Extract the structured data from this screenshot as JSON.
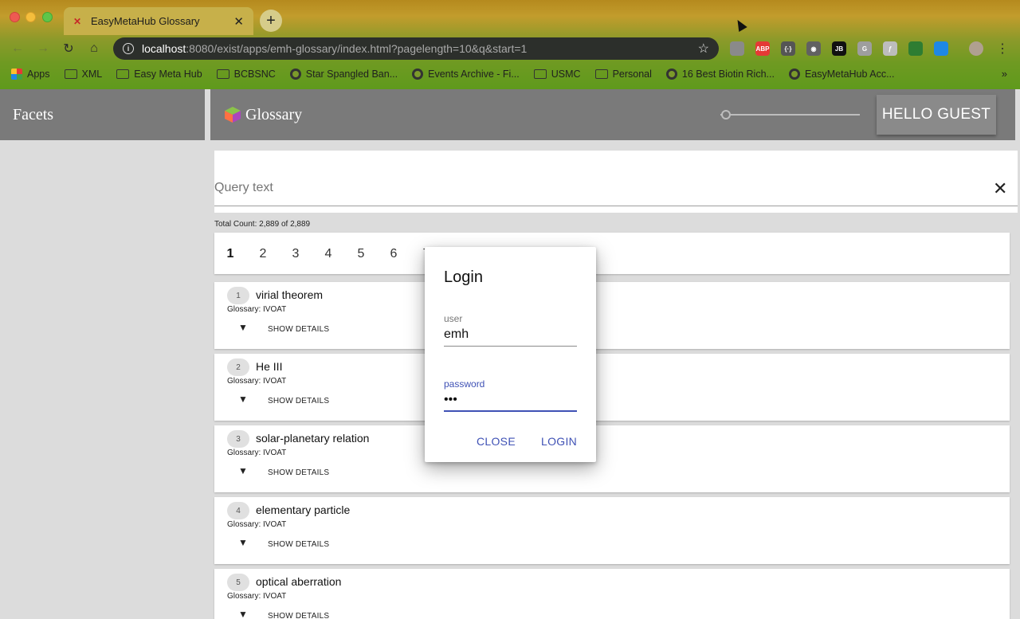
{
  "browser": {
    "tab_title": "EasyMetaHub Glossary",
    "url_host": "localhost",
    "url_path": ":8080/exist/apps/emh-glossary/index.html?pagelength=10&q&start=1",
    "bookmarks": [
      "Apps",
      "XML",
      "Easy Meta Hub",
      "BCBSNC",
      "Star Spangled Ban...",
      "Events Archive - Fi...",
      "USMC",
      "Personal",
      "16 Best Biotin Rich...",
      "EasyMetaHub Acc..."
    ],
    "bookmark_more": "»",
    "extensions": [
      {
        "name": "gear-extension-icon",
        "text": "",
        "color": "#8a8a8a"
      },
      {
        "name": "adblock-extension-icon",
        "text": "ABP",
        "color": "#e53935"
      },
      {
        "name": "code-extension-icon",
        "text": "{·}",
        "color": "#555555"
      },
      {
        "name": "circle-extension-icon",
        "text": "◉",
        "color": "#616161"
      },
      {
        "name": "jetbrains-extension-icon",
        "text": "JB",
        "color": "#111111"
      },
      {
        "name": "g-extension-icon",
        "text": "G",
        "color": "#9e9e9e"
      },
      {
        "name": "translate-extension-icon",
        "text": "ƒ",
        "color": "#bdbdbd"
      },
      {
        "name": "chat-extension-icon",
        "text": "",
        "color": "#2e7d32"
      },
      {
        "name": "window-extension-icon",
        "text": "",
        "color": "#1e88e5"
      }
    ]
  },
  "sidebar": {
    "title": "Facets"
  },
  "header": {
    "title": "Glossary",
    "user_button": "HELLO GUEST"
  },
  "search": {
    "placeholder": "Query text",
    "clear_icon": "✕"
  },
  "total_count": "Total Count: 2,889 of 2,889",
  "pager": {
    "pages": [
      "1",
      "2",
      "3",
      "4",
      "5",
      "6",
      "7"
    ],
    "active": "1"
  },
  "results": [
    {
      "num": "1",
      "term": "virial theorem",
      "glossary": "Glossary: IVOAT",
      "action": "SHOW DETAILS"
    },
    {
      "num": "2",
      "term": "He III",
      "glossary": "Glossary: IVOAT",
      "action": "SHOW DETAILS"
    },
    {
      "num": "3",
      "term": "solar-planetary relation",
      "glossary": "Glossary: IVOAT",
      "action": "SHOW DETAILS"
    },
    {
      "num": "4",
      "term": "elementary particle",
      "glossary": "Glossary: IVOAT",
      "action": "SHOW DETAILS"
    },
    {
      "num": "5",
      "term": "optical aberration",
      "glossary": "Glossary: IVOAT",
      "action": "SHOW DETAILS"
    }
  ],
  "login": {
    "title": "Login",
    "user_label": "user",
    "user_value": "emh",
    "password_label": "password",
    "password_value": "•••",
    "close_label": "CLOSE",
    "login_label": "LOGIN"
  },
  "colors": {
    "accent": "#3f51b5",
    "header_gray": "#7a7a7a"
  }
}
